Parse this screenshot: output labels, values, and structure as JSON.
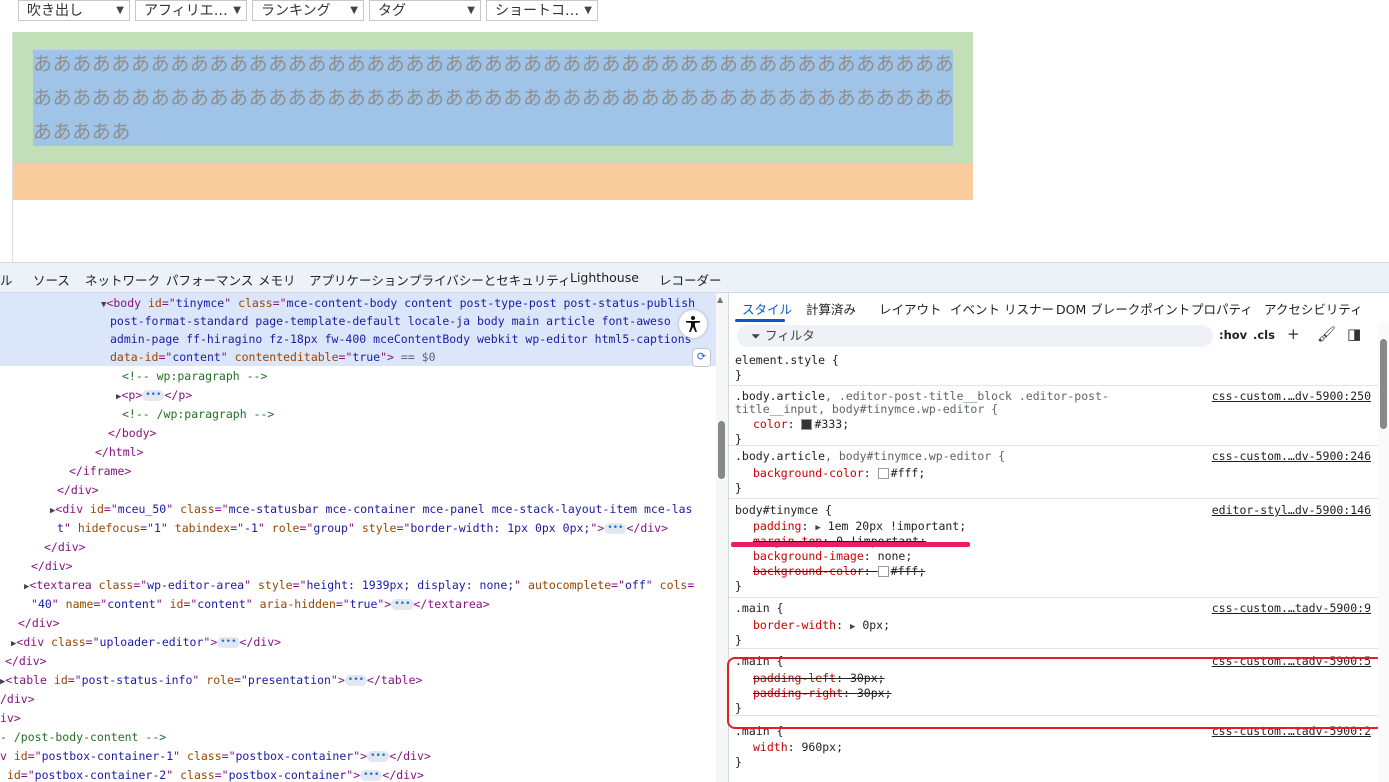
{
  "toolbar": {
    "dropdowns": [
      "吹き出し",
      "アフィリエ…",
      "ランキング",
      "タグ",
      "ショートコ…"
    ]
  },
  "editor": {
    "content_text": "あああああああああああああああああああああああああああああああああああああああああああああああああああああああああああああああああああああああああああああああああああああああああああああああああああ",
    "colors": {
      "margin": "#f9cc9d",
      "padding": "#c3dfb8",
      "content": "#9fc4e7"
    }
  },
  "devtools": {
    "tabs": [
      "ル",
      "ソース",
      "ネットワーク",
      "パフォーマンス",
      "メモリ",
      "アプリケーション",
      "プライバシーとセキュリティ",
      "Lighthouse",
      "レコーダー"
    ],
    "elements": {
      "body_open": {
        "tag": "body",
        "id_attr": "id",
        "id_val": "tinymce",
        "class_attr": "class",
        "class_val_l1": "mce-content-body content post-type-post post-status-publish",
        "class_val_l2": "post-format-standard page-template-default locale-ja body main article font-aweso",
        "class_val_l3": "admin-page ff-hiragino fz-18px fw-400 mceContentBody webkit wp-editor html5-captions",
        "data_attr": "data-id",
        "data_val": "content",
        "ce_attr": "contenteditable",
        "ce_val": "true",
        "eq": "== $0"
      },
      "comment1": "<!-- wp:paragraph -->",
      "p_line": "<p>",
      "p_close": "</p>",
      "comment2": "<!-- /wp:paragraph -->",
      "body_close": "</body>",
      "html_close": "</html>",
      "iframe_close": "</iframe>",
      "div_close1": "</div>",
      "mceu_l1_a": "<div ",
      "mceu_id_attr": "id",
      "mceu_id_val": "mceu_50",
      "mceu_class_attr": "class",
      "mceu_class_val": "mce-statusbar mce-container mce-panel mce-stack-layout-item mce-las",
      "mceu_l2_a": "t",
      "mceu_hf_attr": "hidefocus",
      "mceu_hf_val": "1",
      "mceu_ti_attr": "tabindex",
      "mceu_ti_val": "-1",
      "mceu_role_attr": "role",
      "mceu_role_val": "group",
      "mceu_style_attr": "style",
      "mceu_style_val": "border-width: 1px 0px 0px;",
      "div_close2": "</div>",
      "div_close3": "</div>",
      "ta_tag": "<textarea ",
      "ta_class_attr": "class",
      "ta_class_val": "wp-editor-area",
      "ta_style_attr": "style",
      "ta_style_val": "height: 1939px; display: none;",
      "ta_ac_attr": "autocomplete",
      "ta_ac_val": "off",
      "ta_cols_attr": "cols",
      "ta_cols_val": "40",
      "ta_name_attr": "name",
      "ta_name_val": "content",
      "ta_id_attr": "id",
      "ta_id_val": "content",
      "ta_aria_attr": "aria-hidden",
      "ta_aria_val": "true",
      "ta_close": "</textarea>",
      "div_close4": "</div>",
      "uploader_tag": "<div ",
      "uploader_class_attr": "class",
      "uploader_class_val": "uploader-editor",
      "div_close5": "</div>",
      "div_close6": "</div>",
      "table_tag": "<table ",
      "table_id_attr": "id",
      "table_id_val": "post-status-info",
      "table_role_attr": "role",
      "table_role_val": "presentation",
      "table_close": "</table>",
      "div_close7": "/div>",
      "div_close8": "iv>",
      "comment3": "- /post-body-content -->",
      "pb1_a": "v ",
      "pb1_id_val": "postbox-container-1",
      "pb_class_val": "postbox-container",
      "pb2_a": " ",
      "pb2_id_val": "postbox-container-2"
    },
    "styles": {
      "tabs": [
        "スタイル",
        "計算済み",
        "レイアウト",
        "イベント リスナー",
        "DOM ブレークポイント",
        "プロパティ",
        "アクセシビリティ"
      ],
      "filter_placeholder": "フィルタ",
      "hov": ":hov",
      "cls": ".cls",
      "rules": {
        "r0": {
          "sel": "element.style {",
          "close": "}"
        },
        "r1": {
          "sel_l1a": ".body.article",
          "sel_l1b": ", .editor-post-title__block .editor-post-",
          "sel_l2": "title__input, body#tinymce.wp-editor {",
          "prop": "color",
          "val": "#333",
          "swatch": "#333333",
          "src": "css-custom.…dv-5900:250",
          "close": "}"
        },
        "r2": {
          "sel_a": ".body.article",
          "sel_b": ", body#tinymce.wp-editor {",
          "prop": "background-color",
          "val": "#fff",
          "swatch": "#ffffff",
          "src": "css-custom.…dv-5900:246",
          "close": "}"
        },
        "r3": {
          "sel": "body#tinymce {",
          "src": "editor-styl…dv-5900:146",
          "p1": "padding",
          "v1": "1em 20px !important;",
          "p2": "margin-top",
          "v2": "0 !important;",
          "p3": "background-image",
          "v3": "none;",
          "p4": "background-color",
          "v4": "#fff;",
          "close": "}"
        },
        "r4": {
          "sel": ".main {",
          "prop": "border-width",
          "val": "0px;",
          "src": "css-custom.…tadv-5900:9",
          "close": "}"
        },
        "r5": {
          "sel": ".main {",
          "p1": "padding-left",
          "v1": "30px;",
          "p2": "padding-right",
          "v2": "30px;",
          "src": "css-custom.…tadv-5900:5",
          "close": "}"
        },
        "r6": {
          "sel": ".main {",
          "prop": "width",
          "val": "960px;",
          "src": "css-custom.…tadv-5900:2",
          "close": "}"
        }
      }
    }
  }
}
